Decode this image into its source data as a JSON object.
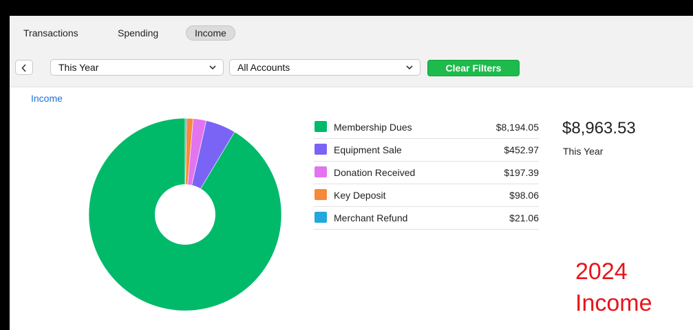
{
  "tabs": [
    {
      "label": "Transactions",
      "active": false
    },
    {
      "label": "Spending",
      "active": false
    },
    {
      "label": "Income",
      "active": true
    }
  ],
  "filters": {
    "period": "This Year",
    "account": "All Accounts",
    "clear_label": "Clear Filters"
  },
  "section_title": "Income",
  "summary": {
    "total": "$8,963.53",
    "period": "This Year"
  },
  "annotation": {
    "line1": "2024",
    "line2": "Income"
  },
  "colors": {
    "accent_link": "#1e6fd9",
    "clear_button": "#1dbb4b",
    "annotation": "#e8141b"
  },
  "chart_data": {
    "type": "pie",
    "donut": true,
    "categories": [
      "Membership Dues",
      "Equipment Sale",
      "Donation Received",
      "Key Deposit",
      "Merchant Refund"
    ],
    "values": [
      8194.05,
      452.97,
      197.39,
      98.06,
      21.06
    ],
    "value_labels": [
      "$8,194.05",
      "$452.97",
      "$197.39",
      "$98.06",
      "$21.06"
    ],
    "colors": [
      "#00ba6a",
      "#7a64f5",
      "#e374f0",
      "#f7893b",
      "#22a8dc"
    ]
  }
}
